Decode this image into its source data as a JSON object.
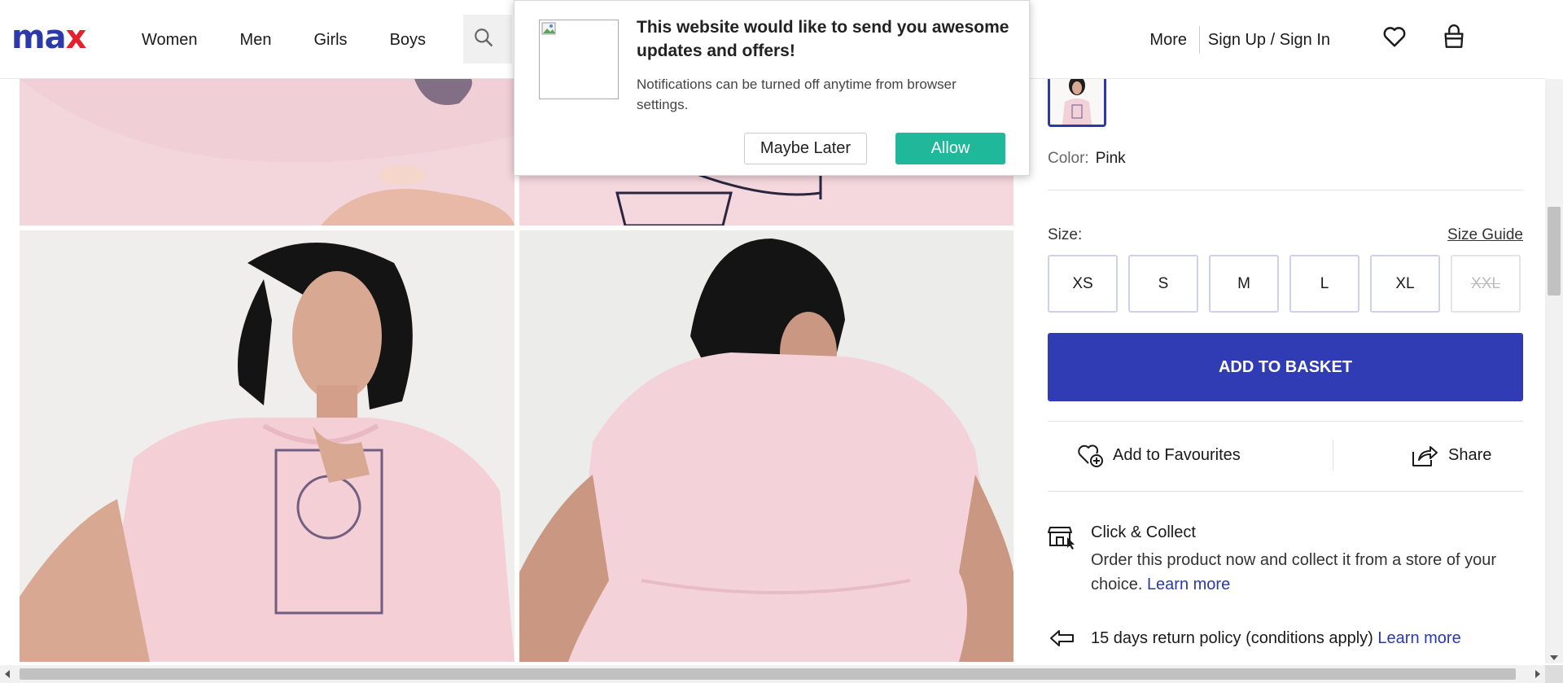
{
  "header": {
    "logo_m": "ma",
    "logo_x": "x",
    "nav": [
      {
        "label": "Women"
      },
      {
        "label": "Men"
      },
      {
        "label": "Girls"
      },
      {
        "label": "Boys"
      }
    ],
    "more": "More",
    "sign_in": "Sign Up / Sign In",
    "icons": [
      "search-icon",
      "heart-icon",
      "basket-icon"
    ]
  },
  "popup": {
    "title": "This website would like to send you awesome updates and offers!",
    "description": "Notifications can be turned off anytime from browser settings.",
    "maybe_later": "Maybe Later",
    "allow": "Allow"
  },
  "product": {
    "color_label": "Color:",
    "color_value": "Pink",
    "size_label": "Size:",
    "size_guide": "Size Guide",
    "sizes": [
      {
        "label": "XS",
        "available": true
      },
      {
        "label": "S",
        "available": true
      },
      {
        "label": "M",
        "available": true
      },
      {
        "label": "L",
        "available": true
      },
      {
        "label": "XL",
        "available": true
      },
      {
        "label": "XXL",
        "available": false
      }
    ],
    "add_to_basket": "ADD TO BASKET",
    "add_to_favourites": "Add to Favourites",
    "share": "Share",
    "click_collect": {
      "title": "Click & Collect",
      "description": "Order this product now and collect it from a store of your choice.",
      "learn_more": "Learn more"
    },
    "return_policy": {
      "text": "15 days return policy (conditions apply)",
      "learn_more": "Learn more"
    }
  },
  "colors": {
    "brand_blue": "#2f3cb4",
    "brand_red": "#e4202e",
    "allow_green": "#1fb89a",
    "product_pink": "#f4d6dc"
  }
}
